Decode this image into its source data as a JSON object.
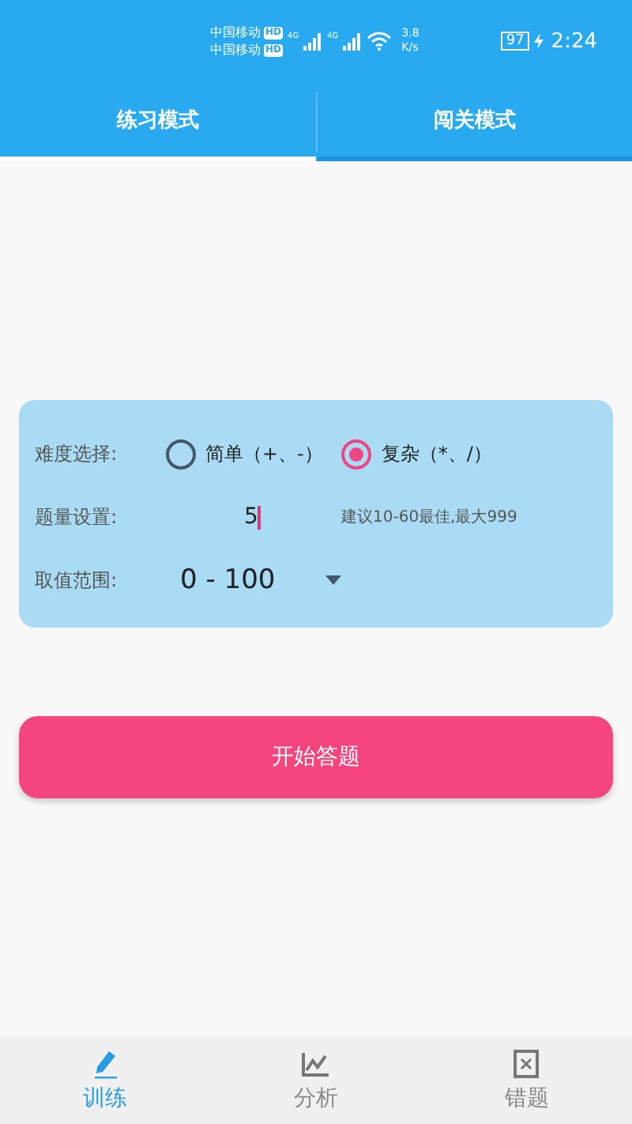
{
  "status_bar": {
    "carrier_1": "中国移动",
    "carrier_2": "中国移动",
    "hd_1": "HD",
    "hd_2": "HD",
    "net_1": "4G",
    "net_2": "4G",
    "speed_value": "3.8",
    "speed_unit": "K/s",
    "battery": "97",
    "time": "2:24"
  },
  "tabs": [
    {
      "label": "练习模式",
      "selected": true
    },
    {
      "label": "闯关模式",
      "selected": false
    }
  ],
  "settings": {
    "difficulty_label": "难度选择:",
    "options": [
      {
        "label": "简单（+、-）",
        "selected": false
      },
      {
        "label": "复杂（*、/）",
        "selected": true
      }
    ],
    "count_label": "题量设置:",
    "count_value": "5",
    "count_hint": "建议10-60最佳,最大999",
    "range_label": "取值范围:",
    "range_value": "0 - 100"
  },
  "start_button": "开始答题",
  "bottom_nav": [
    {
      "label": "训练",
      "kind": "pencil",
      "selected": true
    },
    {
      "label": "分析",
      "kind": "chart",
      "selected": false
    },
    {
      "label": "错题",
      "kind": "note",
      "selected": false
    }
  ]
}
